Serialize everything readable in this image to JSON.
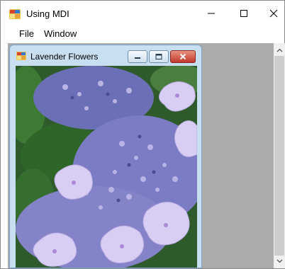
{
  "window": {
    "title": "Using MDI",
    "icon": "app-window-icon",
    "controls": {
      "minimize": "—",
      "maximize": "☐",
      "close": "✕"
    }
  },
  "menu": {
    "items": [
      "File",
      "Window"
    ]
  },
  "child_window": {
    "title": "Lavender Flowers",
    "icon": "app-window-icon",
    "image_subject": "lavender hydrangea flowers photo"
  },
  "scrollbar": {
    "up_icon": "chevron-up-icon",
    "down_icon": "chevron-down-icon"
  },
  "colors": {
    "mdi_background": "#ababab",
    "child_frame": "#c8dff2",
    "close_button": "#c0392b"
  }
}
